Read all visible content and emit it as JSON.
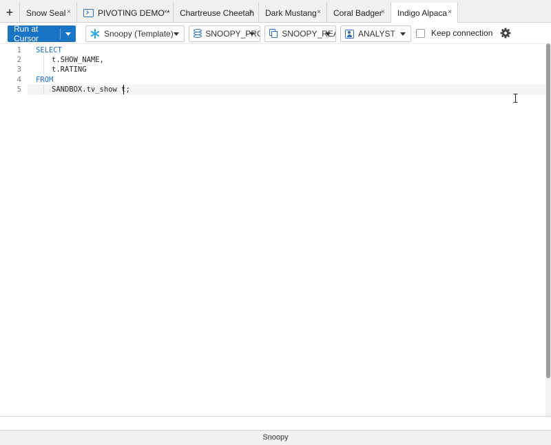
{
  "tabs": {
    "add_symbol": "+",
    "close_symbol": "×",
    "items": [
      {
        "label": "Snow Seal"
      },
      {
        "label": "PIVOTING DEMO *",
        "icon": "terminal-icon"
      },
      {
        "label": "Chartreuse Cheetah"
      },
      {
        "label": "Dark Mustang"
      },
      {
        "label": "Coral Badger"
      },
      {
        "label": "Indigo Alpaca",
        "active": true
      }
    ]
  },
  "toolbar": {
    "run_label": "Run at Cursor",
    "connection": {
      "label": "Snoopy (Template)",
      "icon": "snowflake-icon"
    },
    "database": {
      "label": "SNOOPY_PRO",
      "icon": "database-icon"
    },
    "schema": {
      "label": "SNOOPY_REA",
      "icon": "schema-icon"
    },
    "role": {
      "label": "ANALYST",
      "icon": "role-icon"
    },
    "keep_connection": {
      "label": "Keep connection",
      "checked": false
    },
    "settings_icon": "gear-icon",
    "accent_color": "#1a74c6"
  },
  "editor": {
    "line_numbers": [
      "1",
      "2",
      "3",
      "4",
      "5"
    ],
    "lines": {
      "l1": "SELECT",
      "l2": "t.SHOW_NAME,",
      "l3": "t.RATING",
      "l4": "FROM",
      "l5": "SANDBOX.tv_show t;"
    },
    "keyword_color": "#1a6fd1",
    "current_line": 5
  },
  "statusbar": {
    "label": "Snoopy"
  }
}
